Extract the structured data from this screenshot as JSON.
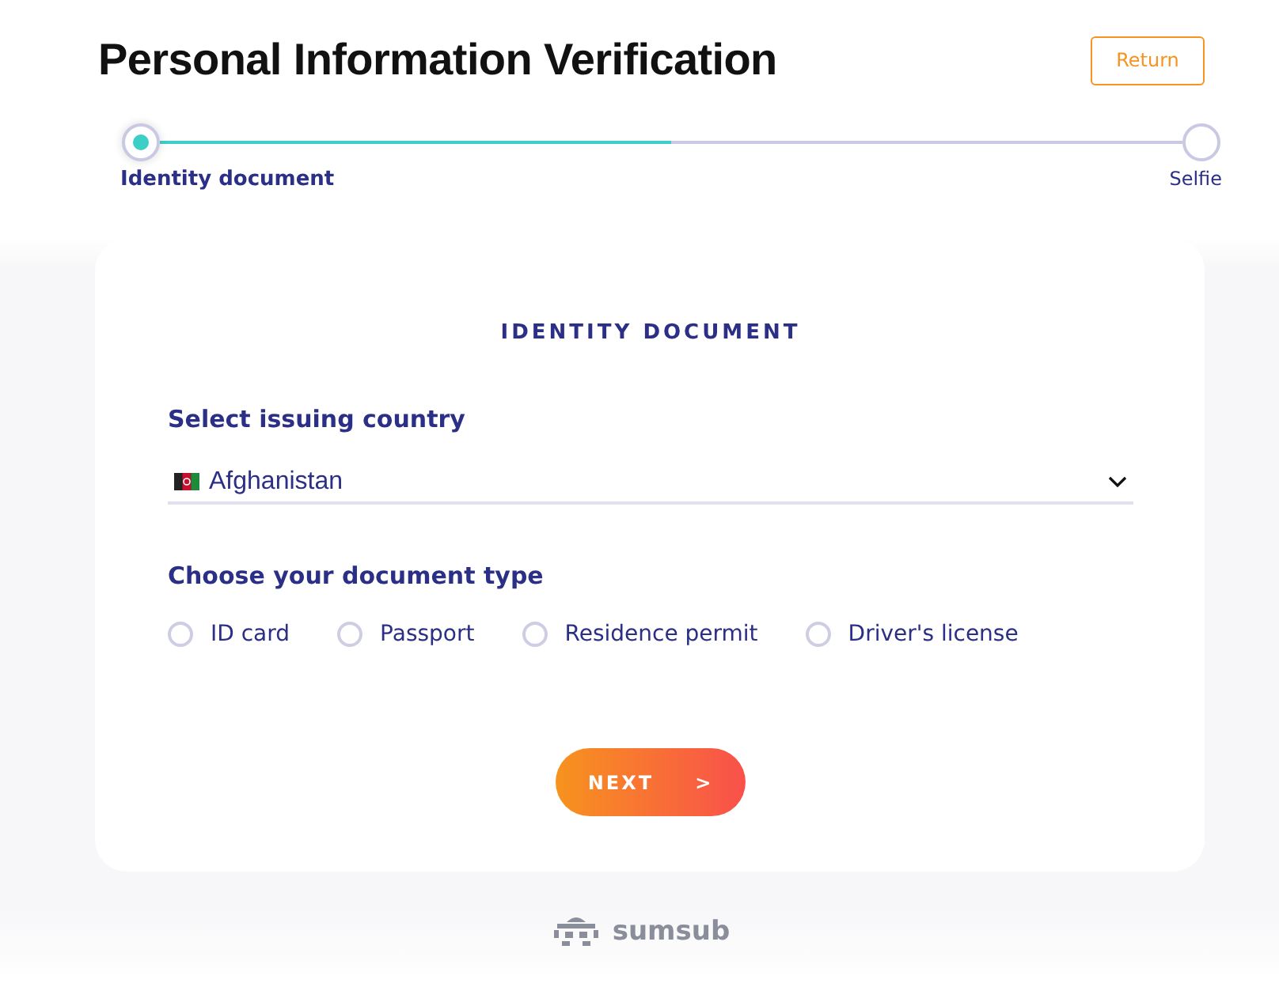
{
  "title": "Personal Information Verification",
  "return_button": "Return",
  "stepper": {
    "level": 0.5,
    "steps": [
      {
        "label": "Identity document",
        "selected": true
      },
      {
        "label": "Selfie",
        "selected": false
      }
    ]
  },
  "card": {
    "heading": "IDENTITY DOCUMENT",
    "country_label": "Select issuing country",
    "country": "Afghanistan",
    "doc_type_label": "Choose your document type",
    "doc_types": [
      {
        "label": "ID card",
        "selected": false
      },
      {
        "label": "Passport",
        "selected": false
      },
      {
        "label": "Residence permit",
        "selected": false
      },
      {
        "label": "Driver's license",
        "selected": false
      }
    ],
    "next_button": {
      "label": "NEXT",
      "arrow": ">"
    }
  },
  "footer_logo": "sumsub"
}
